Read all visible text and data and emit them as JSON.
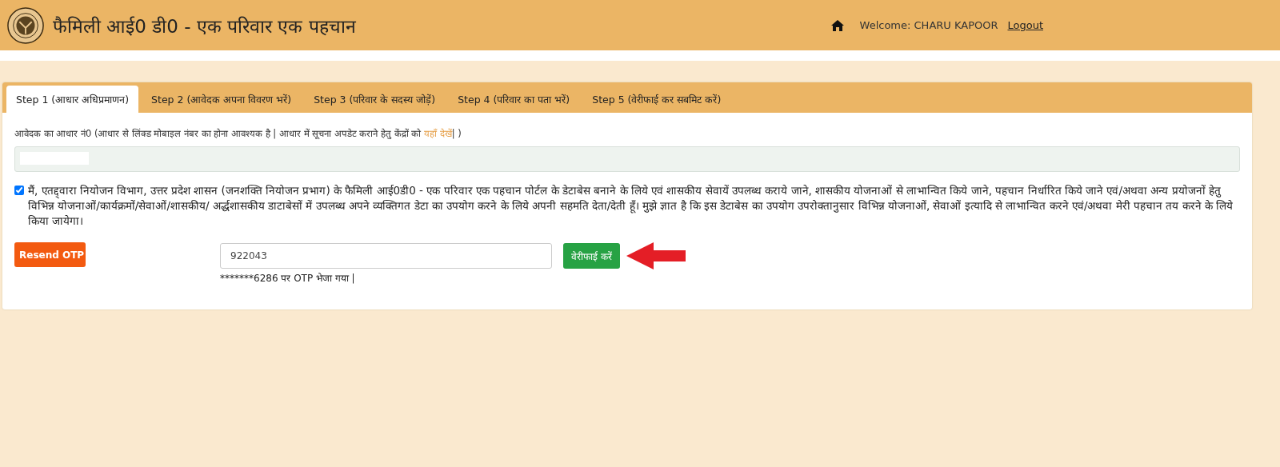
{
  "header": {
    "title": "फैमिली आई0 डी0 - एक परिवार एक पहचान",
    "welcome": "Welcome: CHARU KAPOOR",
    "logout": "Logout"
  },
  "tabs": [
    {
      "label": "Step 1 (आधार अधिप्रमाणन)",
      "selected": true
    },
    {
      "label": "Step 2 (आवेदक अपना विवरण भरें)",
      "selected": false
    },
    {
      "label": "Step 3 (परिवार के सदस्य जोड़ें)",
      "selected": false
    },
    {
      "label": "Step 4 (परिवार का पता भरें)",
      "selected": false
    },
    {
      "label": "Step 5 (वेरीफाई कर सबमिट करें)",
      "selected": false
    }
  ],
  "aadhaar": {
    "label_before": "आवेदक का आधार नं0 (आधार से लिंक्ड मोबाइल नंबर का होना आवश्यक है | आधार में सूचना अपडेट कराने हेतु केंद्रों को ",
    "link": "यहाँ देखें",
    "label_after": "| )"
  },
  "consent": {
    "checked": true,
    "text": "मैं, एतद्द्वारा नियोजन विभाग, उत्तर प्रदेश शासन (जनशक्ति नियोजन प्रभाग) के फैमिली आई0डी0 - एक परिवार एक पहचान पोर्टल के डेटाबेस बनाने के लिये एवं शासकीय सेवायें उपलब्ध कराये जाने, शासकीय योजनाओं से लाभान्वित किये जाने, पहचान निर्धारित किये जाने एवं/अथवा अन्य प्रयोजनों हेतु विभिन्न योजनाओं/कार्यक्रमों/सेवाओं/शासकीय/ अर्द्धशासकीय डाटाबेसों में उपलब्ध अपने व्यक्तिगत डेटा का उपयोग करने के लिये अपनी सहमति देता/देती हूँ। मुझे ज्ञात है कि इस डेटाबेस का उपयोग उपरोक्तानुसार विभिन्न योजनाओं, सेवाओं इत्यादि से लाभान्वित करने एवं/अथवा मेरी पहचान तय करने के लिये किया जायेगा।"
  },
  "otp": {
    "resend": "Resend OTP",
    "value": "922043",
    "verify": "वेरीफाई करें",
    "sent_note": "*******6286 पर OTP भेजा गया |"
  }
}
